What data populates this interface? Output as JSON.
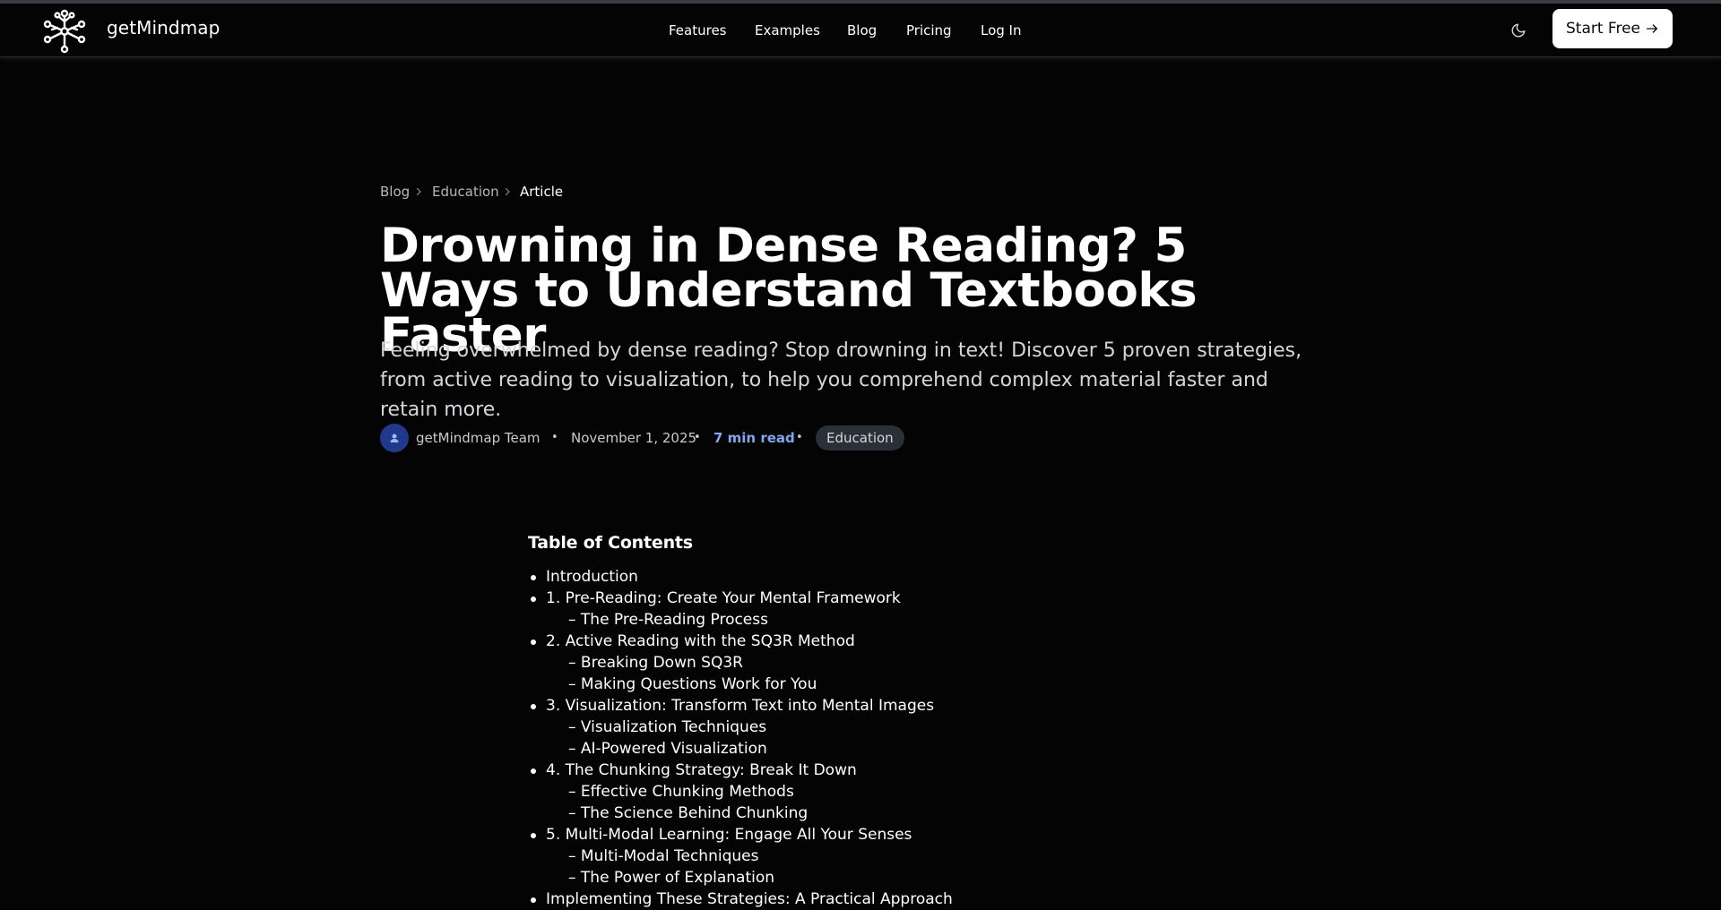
{
  "header": {
    "brand": "getMindmap",
    "logo_icon": "mindmap-network-icon",
    "nav": [
      "Features",
      "Examples",
      "Blog",
      "Pricing",
      "Log In"
    ],
    "theme_icon": "moon-icon",
    "cta_label": "Start Free",
    "cta_icon": "arrow-right-icon"
  },
  "breadcrumb": {
    "items": [
      "Blog",
      "Education",
      "Article"
    ],
    "separator_icon": "chevron-right-icon"
  },
  "article": {
    "title": "Drowning in Dense Reading? 5 Ways to Understand Textbooks Faster",
    "subtitle": "Feeling overwhelmed by dense reading? Stop drowning in text! Discover 5 proven strategies, from active reading to visualization, to help you comprehend complex material faster and retain more.",
    "author": "getMindmap Team",
    "date": "November 1, 2025",
    "read_time": "7 min read",
    "category": "Education",
    "separator": "•"
  },
  "toc": {
    "title": "Table of Contents",
    "items": [
      "Introduction",
      "1. Pre-Reading: Create Your Mental Framework",
      "– The Pre-Reading Process",
      "2. Active Reading with the SQ3R Method",
      "– Breaking Down SQ3R",
      "– Making Questions Work for You",
      "3. Visualization: Transform Text into Mental Images",
      "– Visualization Techniques",
      "– AI-Powered Visualization",
      "4. The Chunking Strategy: Break It Down",
      "– Effective Chunking Methods",
      "– The Science Behind Chunking",
      "5. Multi-Modal Learning: Engage All Your Senses",
      "– Multi-Modal Techniques",
      "– The Power of Explanation",
      "Implementing These Strategies: A Practical Approach"
    ]
  },
  "colors": {
    "background": "#040404",
    "accent_blue": "#7fa8f0",
    "avatar_bg": "#1f3a8c",
    "tag_bg": "#2a3038"
  }
}
